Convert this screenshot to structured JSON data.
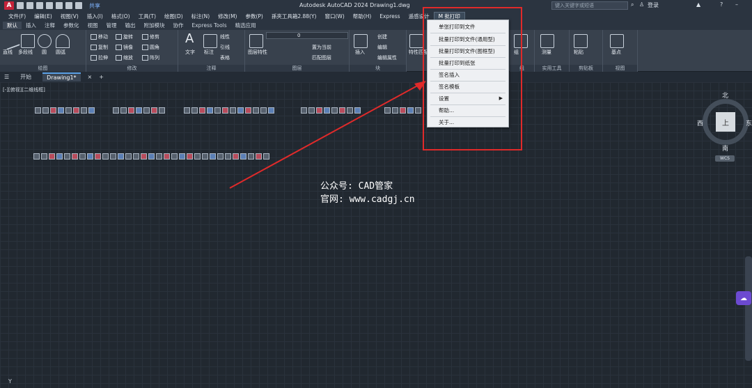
{
  "title_bar": {
    "app_logo": "A",
    "share_label": "共享",
    "title": "Autodesk AutoCAD 2024   Drawing1.dwg",
    "search_placeholder": "键入关键字或短语",
    "user_label": "登录",
    "help_label": "?"
  },
  "menubar": {
    "items": [
      "文件(F)",
      "编辑(E)",
      "视图(V)",
      "插入(I)",
      "格式(O)",
      "工具(T)",
      "绘图(D)",
      "标注(N)",
      "修改(M)",
      "参数(P)",
      "孫夾工具箱2.88(Y)",
      "窗口(W)",
      "帮助(H)",
      "Express",
      "遥感设计"
    ],
    "active_item": "M  批打印"
  },
  "ribbon_tabs": [
    "默认",
    "插入",
    "注释",
    "参数化",
    "视图",
    "管理",
    "输出",
    "附加模块",
    "协作",
    "Express Tools",
    "精选应用"
  ],
  "ribbon": {
    "draw": {
      "title": "绘图",
      "line": "直线",
      "polyline": "多段线",
      "circle": "圆",
      "arc": "圆弧"
    },
    "modify": {
      "title": "修改",
      "move": "移动",
      "rotate": "旋转",
      "trim": "修剪",
      "copy": "复制",
      "mirror": "镜像",
      "fillet": "圆角",
      "stretch": "拉伸",
      "scale": "缩放",
      "array": "阵列"
    },
    "annotation": {
      "title": "注释",
      "text": "文字",
      "dimension": "标注",
      "linear": "线性",
      "leader": "引线",
      "table": "表格"
    },
    "layers": {
      "title": "图层",
      "properties": "图层特性",
      "layer_value": "0",
      "set_current": "置为当前",
      "match_layer": "匹配图层"
    },
    "block": {
      "title": "块",
      "insert": "插入",
      "create": "创建",
      "edit": "编辑",
      "edit_attr": "编辑属性"
    },
    "properties": {
      "title": "特性",
      "match": "特性匹配"
    },
    "groups": {
      "title": "组",
      "group": "组"
    },
    "utilities": {
      "title": "实用工具",
      "measure": "测量"
    },
    "clipboard": {
      "title": "剪贴板",
      "paste": "粘贴"
    },
    "view": {
      "title": "视图",
      "base": "基点"
    }
  },
  "doc_tabs": {
    "home": "开始",
    "current": "Drawing1*",
    "add": "+"
  },
  "canvas": {
    "view_label": "[-][俯视][二维线框]",
    "cube_top": "上",
    "north": "北",
    "south": "南",
    "east": "东",
    "west": "西",
    "wcs": "WCS",
    "ucs": "Y"
  },
  "dropdown": {
    "items": [
      "单张打印到文件",
      "批量打印到文件(通用型)",
      "批量打印到文件(图框型)",
      "批量打印到纸张",
      "签名插入",
      "签名模板",
      "设置",
      "帮助...",
      "关于..."
    ]
  },
  "watermark": {
    "line1": "公众号: CAD管家",
    "line2": "官网: www.cadgj.cn"
  },
  "colors": {
    "accent": "#e02a2a",
    "background": "#212830",
    "ribbon": "#38414d"
  }
}
